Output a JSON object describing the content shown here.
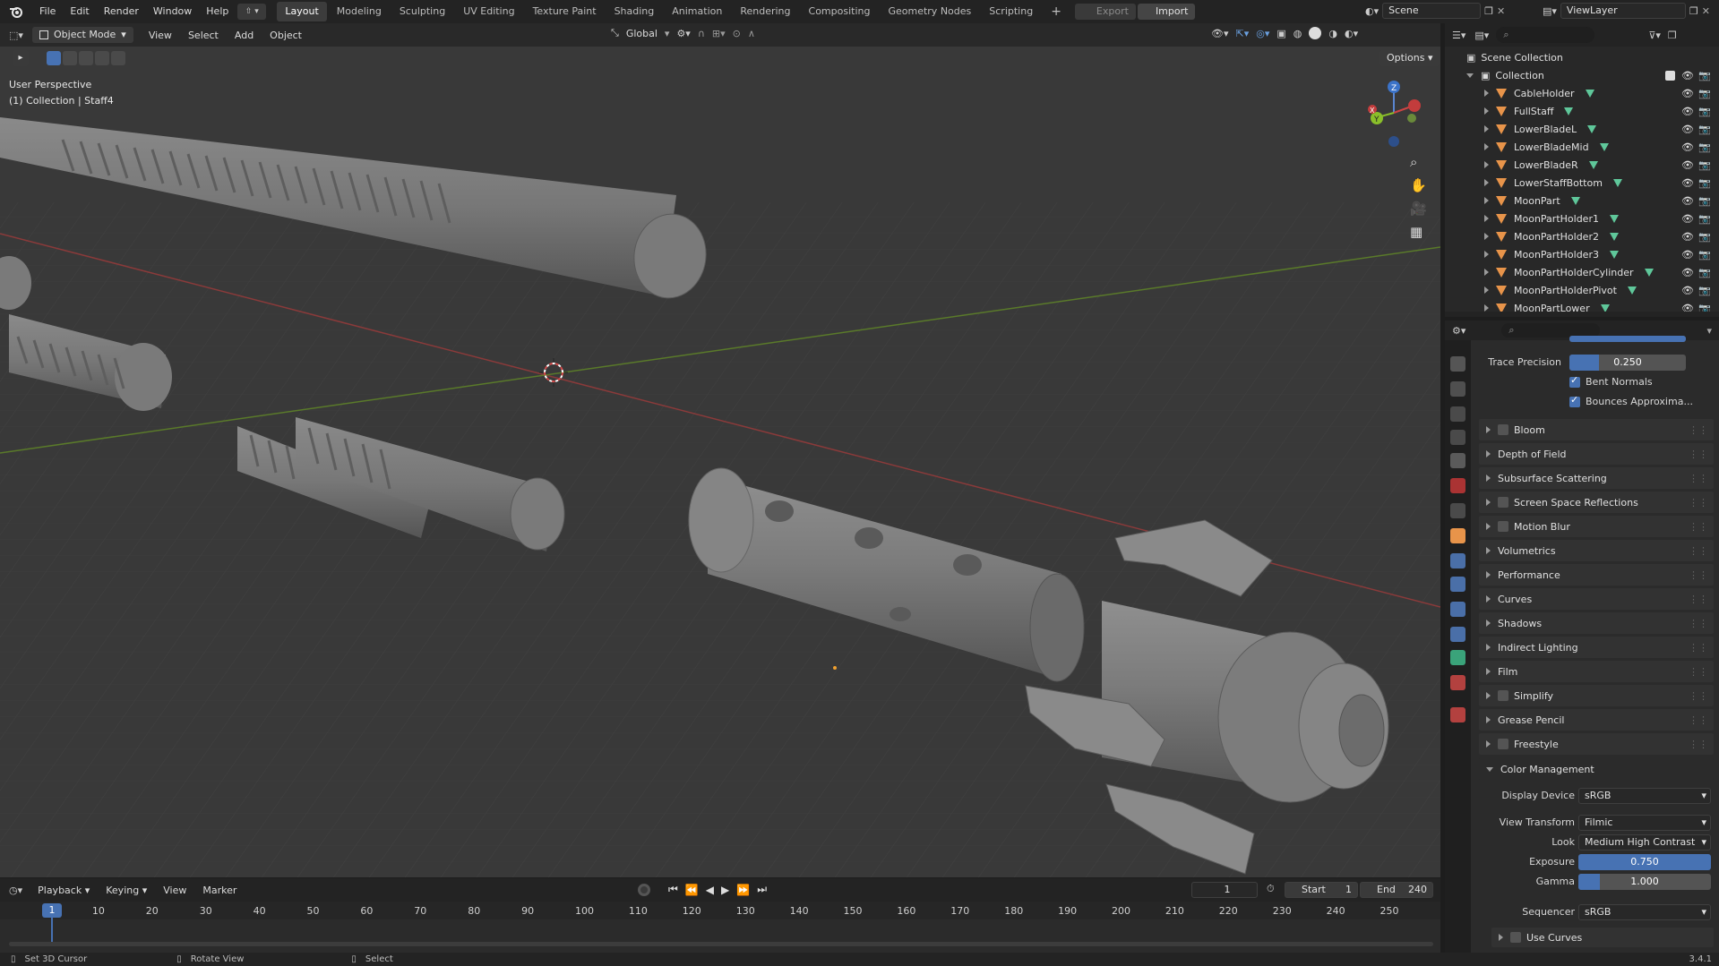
{
  "topbar": {
    "menus": [
      "File",
      "Edit",
      "Render",
      "Window",
      "Help"
    ],
    "workspaces": [
      "Layout",
      "Modeling",
      "Sculpting",
      "UV Editing",
      "Texture Paint",
      "Shading",
      "Animation",
      "Rendering",
      "Compositing",
      "Geometry Nodes",
      "Scripting"
    ],
    "active_workspace": "Layout",
    "export_label": "Export",
    "import_label": "Import",
    "scene_name": "Scene",
    "view_layer": "ViewLayer"
  },
  "viewport": {
    "mode": "Object Mode",
    "menus": [
      "View",
      "Select",
      "Add",
      "Object"
    ],
    "orientation": "Global",
    "options_label": "Options",
    "perspective_label": "User Perspective",
    "collection_label": "(1) Collection | Staff4",
    "gizmo_axes": [
      "X",
      "Y",
      "Z"
    ]
  },
  "outliner": {
    "root": "Scene Collection",
    "collection": "Collection",
    "items": [
      "CableHolder",
      "FullStaff",
      "LowerBladeL",
      "LowerBladeMid",
      "LowerBladeR",
      "LowerStaffBottom",
      "MoonPart",
      "MoonPartHolder1",
      "MoonPartHolder2",
      "MoonPartHolder3",
      "MoonPartHolderCylinder",
      "MoonPartHolderPivot",
      "MoonPartLower"
    ]
  },
  "properties": {
    "trace_precision_label": "Trace Precision",
    "trace_precision_value": "0.250",
    "trace_precision_fraction": 0.25,
    "bent_normals_label": "Bent Normals",
    "bounces_label": "Bounces Approxima...",
    "panels": [
      {
        "label": "Bloom",
        "checkbox": true
      },
      {
        "label": "Depth of Field",
        "checkbox": false
      },
      {
        "label": "Subsurface Scattering",
        "checkbox": false
      },
      {
        "label": "Screen Space Reflections",
        "checkbox": true
      },
      {
        "label": "Motion Blur",
        "checkbox": true
      },
      {
        "label": "Volumetrics",
        "checkbox": false
      },
      {
        "label": "Performance",
        "checkbox": false
      },
      {
        "label": "Curves",
        "checkbox": false
      },
      {
        "label": "Shadows",
        "checkbox": false
      },
      {
        "label": "Indirect Lighting",
        "checkbox": false
      },
      {
        "label": "Film",
        "checkbox": false
      },
      {
        "label": "Simplify",
        "checkbox": true
      },
      {
        "label": "Grease Pencil",
        "checkbox": false
      },
      {
        "label": "Freestyle",
        "checkbox": true
      }
    ],
    "color_management": {
      "title": "Color Management",
      "display_device_label": "Display Device",
      "display_device": "sRGB",
      "view_transform_label": "View Transform",
      "view_transform": "Filmic",
      "look_label": "Look",
      "look": "Medium High Contrast",
      "exposure_label": "Exposure",
      "exposure": "0.750",
      "gamma_label": "Gamma",
      "gamma": "1.000",
      "sequencer_label": "Sequencer",
      "sequencer": "sRGB",
      "use_curves_label": "Use Curves"
    }
  },
  "timeline": {
    "menus": [
      "Playback",
      "Keying",
      "View",
      "Marker"
    ],
    "current_frame": "1",
    "start_label": "Start",
    "start": "1",
    "end_label": "End",
    "end": "240",
    "ticks": [
      "1",
      "10",
      "20",
      "30",
      "40",
      "50",
      "60",
      "70",
      "80",
      "90",
      "100",
      "110",
      "120",
      "130",
      "140",
      "150",
      "160",
      "170",
      "180",
      "190",
      "200",
      "210",
      "220",
      "230",
      "240",
      "250"
    ]
  },
  "statusbar": {
    "hint1": "Set 3D Cursor",
    "hint2": "Rotate View",
    "hint3": "Select",
    "version": "3.4.1"
  }
}
